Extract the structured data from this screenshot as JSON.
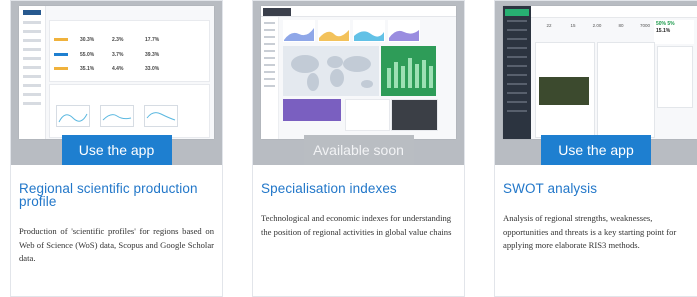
{
  "cards": [
    {
      "title": "Regional scientific production profile",
      "button": "Use the app",
      "button_state": "enabled",
      "description": "Production of 'scientific profiles' for regions based on Web of Science (WoS) data, Scopus and Google Scholar data."
    },
    {
      "title": "Specialisation indexes",
      "button": "Available soon",
      "button_state": "disabled",
      "description": "Technological and economic indexes for understanding the position of regional activities in global value chains"
    },
    {
      "title": "SWOT analysis",
      "button": "Use the app",
      "button_state": "enabled",
      "description": "Analysis of regional strengths, weaknesses, opportunities and threats is a key starting point for applying more elaborate RIS3 methods."
    }
  ],
  "colors": {
    "accent": "#1e7fd0",
    "title": "#2277c9",
    "disabled": "#b9bdc2",
    "thumb_band": "#b8bcc2"
  },
  "thumbnails": [
    {
      "percentages": [
        "30.3%",
        "2.3%",
        "17.7%",
        "55.0%",
        "3.7%",
        "39.3%",
        "35.1%",
        "4.4%",
        "33.0%"
      ]
    },
    {},
    {
      "stats": [
        "22",
        "15",
        "2.00",
        "80",
        "7000"
      ],
      "ad": [
        "50% 5%",
        "15.1%"
      ]
    }
  ]
}
